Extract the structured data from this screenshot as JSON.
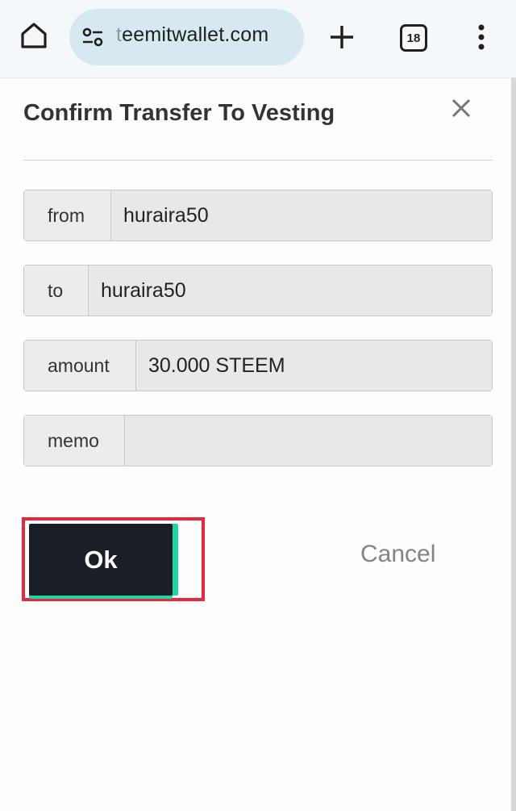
{
  "browser": {
    "url_faded": "t",
    "url": "eemitwallet.com",
    "tab_count": "18",
    "icons": [
      "home-icon",
      "site-info-icon",
      "plus-icon",
      "tabs-icon",
      "more-vert-icon"
    ]
  },
  "dialog": {
    "title": "Confirm Transfer To Vesting",
    "close_icon": "close-icon",
    "fields": {
      "from": {
        "label": "from",
        "value": "huraira50"
      },
      "to": {
        "label": "to",
        "value": "huraira50"
      },
      "amount": {
        "label": "amount",
        "value": "30.000 STEEM"
      },
      "memo": {
        "label": "memo",
        "value": ""
      }
    },
    "ok_label": "Ok",
    "cancel_label": "Cancel"
  },
  "colors": {
    "ok_bg": "#1a1f26",
    "ok_accent": "#1fd6a8",
    "highlight": "#e8273a",
    "url_pill": "#d6e9f1"
  }
}
